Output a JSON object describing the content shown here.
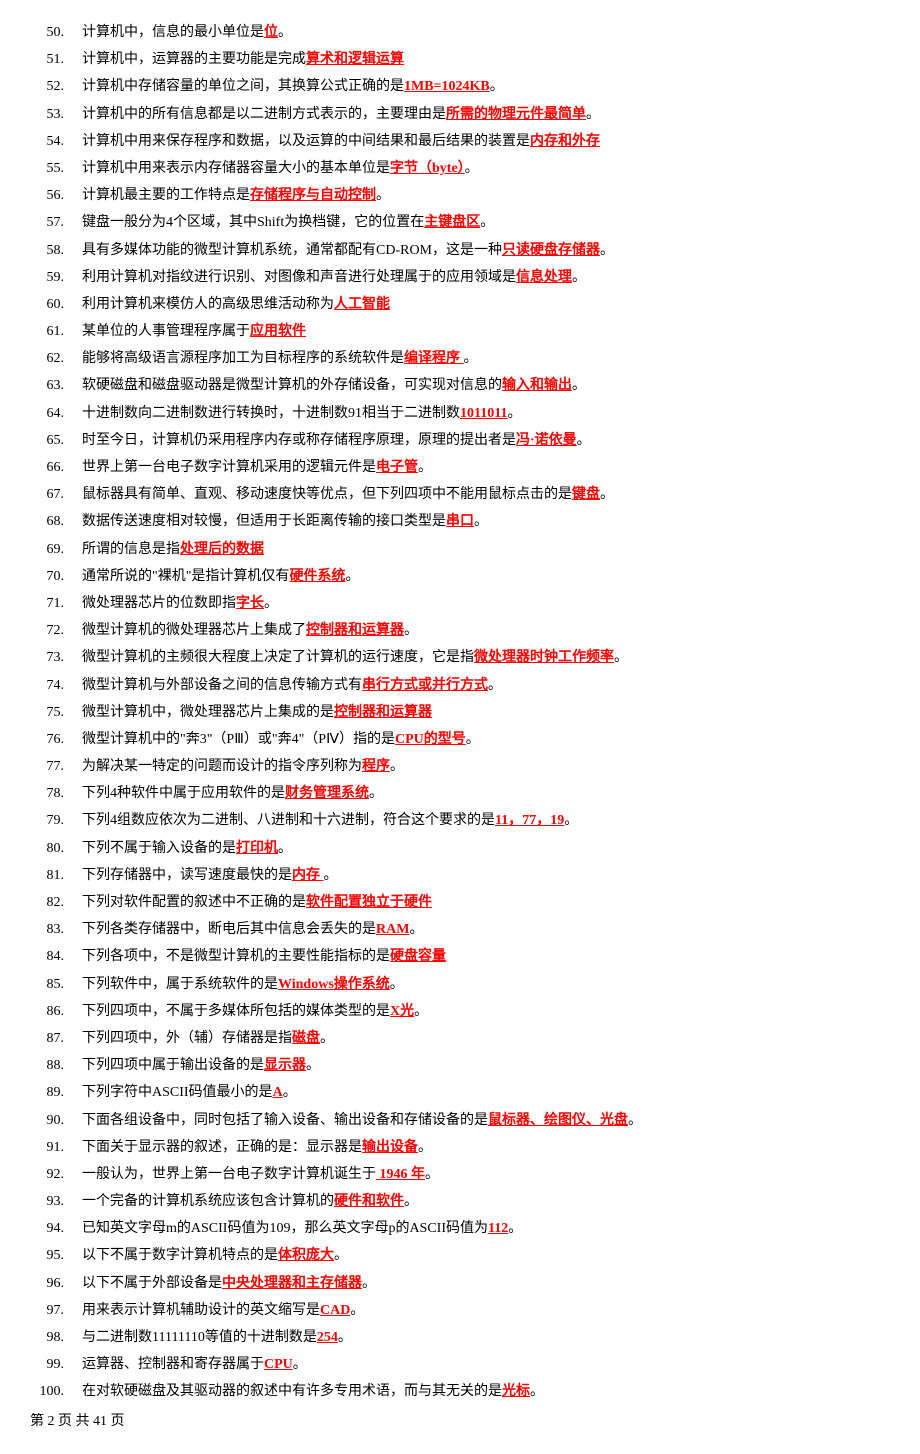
{
  "items": [
    {
      "n": "50.",
      "parts": [
        {
          "t": "计算机中，信息的最小单位是",
          "h": false
        },
        {
          "t": "位",
          "h": true
        },
        {
          "t": "。",
          "h": false
        }
      ]
    },
    {
      "n": "51.",
      "parts": [
        {
          "t": "计算机中，运算器的主要功能是完成",
          "h": false
        },
        {
          "t": "算术和逻辑运算",
          "h": true
        }
      ]
    },
    {
      "n": "52.",
      "parts": [
        {
          "t": "计算机中存储容量的单位之间，其换算公式正确的是",
          "h": false
        },
        {
          "t": "1MB=1024KB",
          "h": true
        },
        {
          "t": "。",
          "h": false
        }
      ]
    },
    {
      "n": "53.",
      "parts": [
        {
          "t": "计算机中的所有信息都是以二进制方式表示的，主要理由是",
          "h": false
        },
        {
          "t": "所需的物理元件最简单",
          "h": true
        },
        {
          "t": "。",
          "h": false
        }
      ]
    },
    {
      "n": "54.",
      "parts": [
        {
          "t": "计算机中用来保存程序和数据，以及运算的中间结果和最后结果的装置是",
          "h": false
        },
        {
          "t": "内存和外存",
          "h": true
        }
      ]
    },
    {
      "n": "55.",
      "parts": [
        {
          "t": "计算机中用来表示内存储器容量大小的基本单位是",
          "h": false
        },
        {
          "t": "字节（byte）",
          "h": true
        },
        {
          "t": "。",
          "h": false
        }
      ]
    },
    {
      "n": "56.",
      "parts": [
        {
          "t": "计算机最主要的工作特点是",
          "h": false
        },
        {
          "t": "存储程序与自动控制",
          "h": true
        },
        {
          "t": "。",
          "h": false
        }
      ]
    },
    {
      "n": "57.",
      "parts": [
        {
          "t": "键盘一般分为4个区域，其中Shift为换档键，它的位置在",
          "h": false
        },
        {
          "t": "主键盘区",
          "h": true
        },
        {
          "t": "。",
          "h": false
        }
      ]
    },
    {
      "n": "58.",
      "parts": [
        {
          "t": "具有多媒体功能的微型计算机系统，通常都配有CD-ROM，这是一种",
          "h": false
        },
        {
          "t": "只读硬盘存储器",
          "h": true
        },
        {
          "t": "。",
          "h": false
        }
      ]
    },
    {
      "n": "59.",
      "parts": [
        {
          "t": "利用计算机对指纹进行识别、对图像和声音进行处理属于的应用领域是",
          "h": false
        },
        {
          "t": "信息处理",
          "h": true
        },
        {
          "t": "。",
          "h": false
        }
      ]
    },
    {
      "n": "60.",
      "parts": [
        {
          "t": "利用计算机来模仿人的高级思维活动称为",
          "h": false
        },
        {
          "t": "人工智能",
          "h": true
        }
      ]
    },
    {
      "n": "61.",
      "parts": [
        {
          "t": "某单位的人事管理程序属于",
          "h": false
        },
        {
          "t": "应用软件",
          "h": true
        }
      ]
    },
    {
      "n": "62.",
      "parts": [
        {
          "t": "能够将高级语言源程序加工为目标程序的系统软件是",
          "h": false
        },
        {
          "t": "编译程序 ",
          "h": true
        },
        {
          "t": "。",
          "h": false
        }
      ]
    },
    {
      "n": "63.",
      "parts": [
        {
          "t": "软硬磁盘和磁盘驱动器是微型计算机的外存储设备，可实现对信息的",
          "h": false
        },
        {
          "t": "输入和输出",
          "h": true
        },
        {
          "t": "。",
          "h": false
        }
      ]
    },
    {
      "n": "64.",
      "parts": [
        {
          "t": "十进制数向二进制数进行转换时，十进制数91相当于二进制数",
          "h": false
        },
        {
          "t": "1011011",
          "h": true
        },
        {
          "t": "。",
          "h": false
        }
      ]
    },
    {
      "n": "65.",
      "parts": [
        {
          "t": "时至今日，计算机仍采用程序内存或称存储程序原理，原理的提出者是",
          "h": false
        },
        {
          "t": "冯·诺依曼",
          "h": true
        },
        {
          "t": "。",
          "h": false
        }
      ]
    },
    {
      "n": "66.",
      "parts": [
        {
          "t": "世界上第一台电子数字计算机采用的逻辑元件是",
          "h": false
        },
        {
          "t": "电子管",
          "h": true
        },
        {
          "t": "。",
          "h": false
        }
      ]
    },
    {
      "n": "67.",
      "parts": [
        {
          "t": "鼠标器具有简单、直观、移动速度快等优点，但下列四项中不能用鼠标点击的是",
          "h": false
        },
        {
          "t": "键盘",
          "h": true
        },
        {
          "t": "。",
          "h": false
        }
      ]
    },
    {
      "n": "68.",
      "parts": [
        {
          "t": "数据传送速度相对较慢，但适用于长距离传输的接口类型是",
          "h": false
        },
        {
          "t": "串口",
          "h": true
        },
        {
          "t": "。",
          "h": false
        }
      ]
    },
    {
      "n": "69.",
      "parts": [
        {
          "t": "所谓的信息是指",
          "h": false
        },
        {
          "t": "处理后的数据",
          "h": true
        }
      ]
    },
    {
      "n": "70.",
      "parts": [
        {
          "t": "通常所说的\"裸机\"是指计算机仅有",
          "h": false
        },
        {
          "t": "硬件系统",
          "h": true
        },
        {
          "t": "。",
          "h": false
        }
      ]
    },
    {
      "n": "71.",
      "parts": [
        {
          "t": "微处理器芯片的位数即指",
          "h": false
        },
        {
          "t": "字长",
          "h": true
        },
        {
          "t": "。",
          "h": false
        }
      ]
    },
    {
      "n": "72.",
      "parts": [
        {
          "t": "微型计算机的微处理器芯片上集成了",
          "h": false
        },
        {
          "t": "控制器和运算器",
          "h": true
        },
        {
          "t": "。",
          "h": false
        }
      ]
    },
    {
      "n": "73.",
      "parts": [
        {
          "t": "微型计算机的主频很大程度上决定了计算机的运行速度，它是指",
          "h": false
        },
        {
          "t": "微处理器时钟工作频率",
          "h": true
        },
        {
          "t": "。",
          "h": false
        }
      ]
    },
    {
      "n": "74.",
      "parts": [
        {
          "t": "微型计算机与外部设备之间的信息传输方式有",
          "h": false
        },
        {
          "t": "串行方式或并行方式",
          "h": true
        },
        {
          "t": "。",
          "h": false
        }
      ]
    },
    {
      "n": "75.",
      "parts": [
        {
          "t": "微型计算机中，微处理器芯片上集成的是",
          "h": false
        },
        {
          "t": "控制器和运算器",
          "h": true
        }
      ]
    },
    {
      "n": "76.",
      "parts": [
        {
          "t": "微型计算机中的\"奔3\"（PⅢ）或\"奔4\"（PⅣ）指的是",
          "h": false
        },
        {
          "t": "CPU的型号",
          "h": true
        },
        {
          "t": "。",
          "h": false
        }
      ]
    },
    {
      "n": "77.",
      "parts": [
        {
          "t": "为解决某一特定的问题而设计的指令序列称为",
          "h": false
        },
        {
          "t": "程序",
          "h": true
        },
        {
          "t": "。",
          "h": false
        }
      ]
    },
    {
      "n": "78.",
      "parts": [
        {
          "t": "下列4种软件中属于应用软件的是",
          "h": false
        },
        {
          "t": "财务管理系统",
          "h": true
        },
        {
          "t": "。",
          "h": false
        }
      ]
    },
    {
      "n": "79.",
      "parts": [
        {
          "t": "下列4组数应依次为二进制、八进制和十六进制，符合这个要求的是",
          "h": false
        },
        {
          "t": "11，77，19",
          "h": true
        },
        {
          "t": "。",
          "h": false
        }
      ]
    },
    {
      "n": "80.",
      "parts": [
        {
          "t": "下列不属于输入设备的是",
          "h": false
        },
        {
          "t": "打印机",
          "h": true
        },
        {
          "t": "。",
          "h": false
        }
      ]
    },
    {
      "n": "81.",
      "parts": [
        {
          "t": "下列存储器中，读写速度最快的是",
          "h": false
        },
        {
          "t": "内存  ",
          "h": true
        },
        {
          "t": "。",
          "h": false
        }
      ]
    },
    {
      "n": "82.",
      "parts": [
        {
          "t": "下列对软件配置的叙述中不正确的是",
          "h": false
        },
        {
          "t": "软件配置独立于硬件  ",
          "h": true
        }
      ]
    },
    {
      "n": "83.",
      "parts": [
        {
          "t": "下列各类存储器中，断电后其中信息会丢失的是",
          "h": false
        },
        {
          "t": "RAM",
          "h": true
        },
        {
          "t": "。",
          "h": false
        }
      ]
    },
    {
      "n": "84.",
      "parts": [
        {
          "t": "下列各项中，不是微型计算机的主要性能指标的是",
          "h": false
        },
        {
          "t": "硬盘容量",
          "h": true
        }
      ]
    },
    {
      "n": "85.",
      "parts": [
        {
          "t": "下列软件中，属于系统软件的是",
          "h": false
        },
        {
          "t": "Windows操作系统",
          "h": true
        },
        {
          "t": "。",
          "h": false
        }
      ]
    },
    {
      "n": "86.",
      "parts": [
        {
          "t": "下列四项中，不属于多媒体所包括的媒体类型的是",
          "h": false
        },
        {
          "t": "X光",
          "h": true
        },
        {
          "t": "。",
          "h": false
        }
      ]
    },
    {
      "n": "87.",
      "parts": [
        {
          "t": "下列四项中，外（辅）存储器是指",
          "h": false
        },
        {
          "t": "磁盘",
          "h": true
        },
        {
          "t": "。",
          "h": false
        }
      ]
    },
    {
      "n": "88.",
      "parts": [
        {
          "t": "下列四项中属于输出设备的是",
          "h": false
        },
        {
          "t": "显示器",
          "h": true
        },
        {
          "t": "。",
          "h": false
        }
      ]
    },
    {
      "n": "89.",
      "parts": [
        {
          "t": "下列字符中ASCII码值最小的是",
          "h": false
        },
        {
          "t": "A",
          "h": true
        },
        {
          "t": "。",
          "h": false
        }
      ]
    },
    {
      "n": "90.",
      "parts": [
        {
          "t": "下面各组设备中，同时包括了输入设备、输出设备和存储设备的是",
          "h": false
        },
        {
          "t": "鼠标器、绘图仪、光盘",
          "h": true
        },
        {
          "t": "。",
          "h": false
        }
      ]
    },
    {
      "n": "91.",
      "parts": [
        {
          "t": "下面关于显示器的叙述，正确的是：显示器是",
          "h": false
        },
        {
          "t": "输出设备",
          "h": true
        },
        {
          "t": "。",
          "h": false
        }
      ]
    },
    {
      "n": "92.",
      "parts": [
        {
          "t": "一般认为，世界上第一台电子数字计算机诞生于",
          "h": false
        },
        {
          "t": " 1946 年",
          "h": true
        },
        {
          "t": "。",
          "h": false
        }
      ]
    },
    {
      "n": "93.",
      "parts": [
        {
          "t": "一个完备的计算机系统应该包含计算机的",
          "h": false
        },
        {
          "t": "硬件和软件",
          "h": true
        },
        {
          "t": "。",
          "h": false
        }
      ]
    },
    {
      "n": "94.",
      "parts": [
        {
          "t": "已知英文字母m的ASCII码值为109，那么英文字母p的ASCII码值为",
          "h": false
        },
        {
          "t": "112",
          "h": true
        },
        {
          "t": "。",
          "h": false
        }
      ]
    },
    {
      "n": "95.",
      "parts": [
        {
          "t": "以下不属于数字计算机特点的是",
          "h": false
        },
        {
          "t": "体积庞大",
          "h": true
        },
        {
          "t": "。",
          "h": false
        }
      ]
    },
    {
      "n": "96.",
      "parts": [
        {
          "t": "以下不属于外部设备是",
          "h": false
        },
        {
          "t": "中央处理器和主存储器",
          "h": true
        },
        {
          "t": "。",
          "h": false
        }
      ]
    },
    {
      "n": "97.",
      "parts": [
        {
          "t": "用来表示计算机辅助设计的英文缩写是",
          "h": false
        },
        {
          "t": "CAD",
          "h": true
        },
        {
          "t": "。",
          "h": false
        }
      ]
    },
    {
      "n": "98.",
      "parts": [
        {
          "t": "与二进制数11111110等值的十进制数是",
          "h": false
        },
        {
          "t": "254",
          "h": true
        },
        {
          "t": "。",
          "h": false
        }
      ]
    },
    {
      "n": "99.",
      "parts": [
        {
          "t": "运算器、控制器和寄存器属于",
          "h": false
        },
        {
          "t": "CPU",
          "h": true
        },
        {
          "t": "。",
          "h": false
        }
      ]
    },
    {
      "n": "100.",
      "parts": [
        {
          "t": "在对软硬磁盘及其驱动器的叙述中有许多专用术语，而与其无关的是",
          "h": false
        },
        {
          "t": "光标",
          "h": true
        },
        {
          "t": "。",
          "h": false
        }
      ]
    }
  ],
  "footer": "第 2 页 共 41 页"
}
